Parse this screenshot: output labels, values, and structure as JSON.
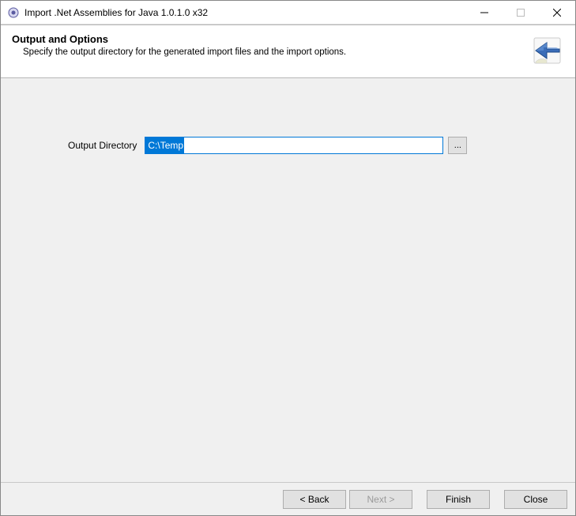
{
  "window": {
    "title": "Import .Net Assemblies for Java 1.0.1.0 x32"
  },
  "banner": {
    "title": "Output and Options",
    "subtitle": "Specify the output directory for the generated import files and the import options."
  },
  "form": {
    "output_dir_label": "Output Directory",
    "output_dir_value": "C:\\Temp",
    "browse_label": "..."
  },
  "footer": {
    "back": "< Back",
    "next": "Next >",
    "finish": "Finish",
    "close": "Close"
  }
}
